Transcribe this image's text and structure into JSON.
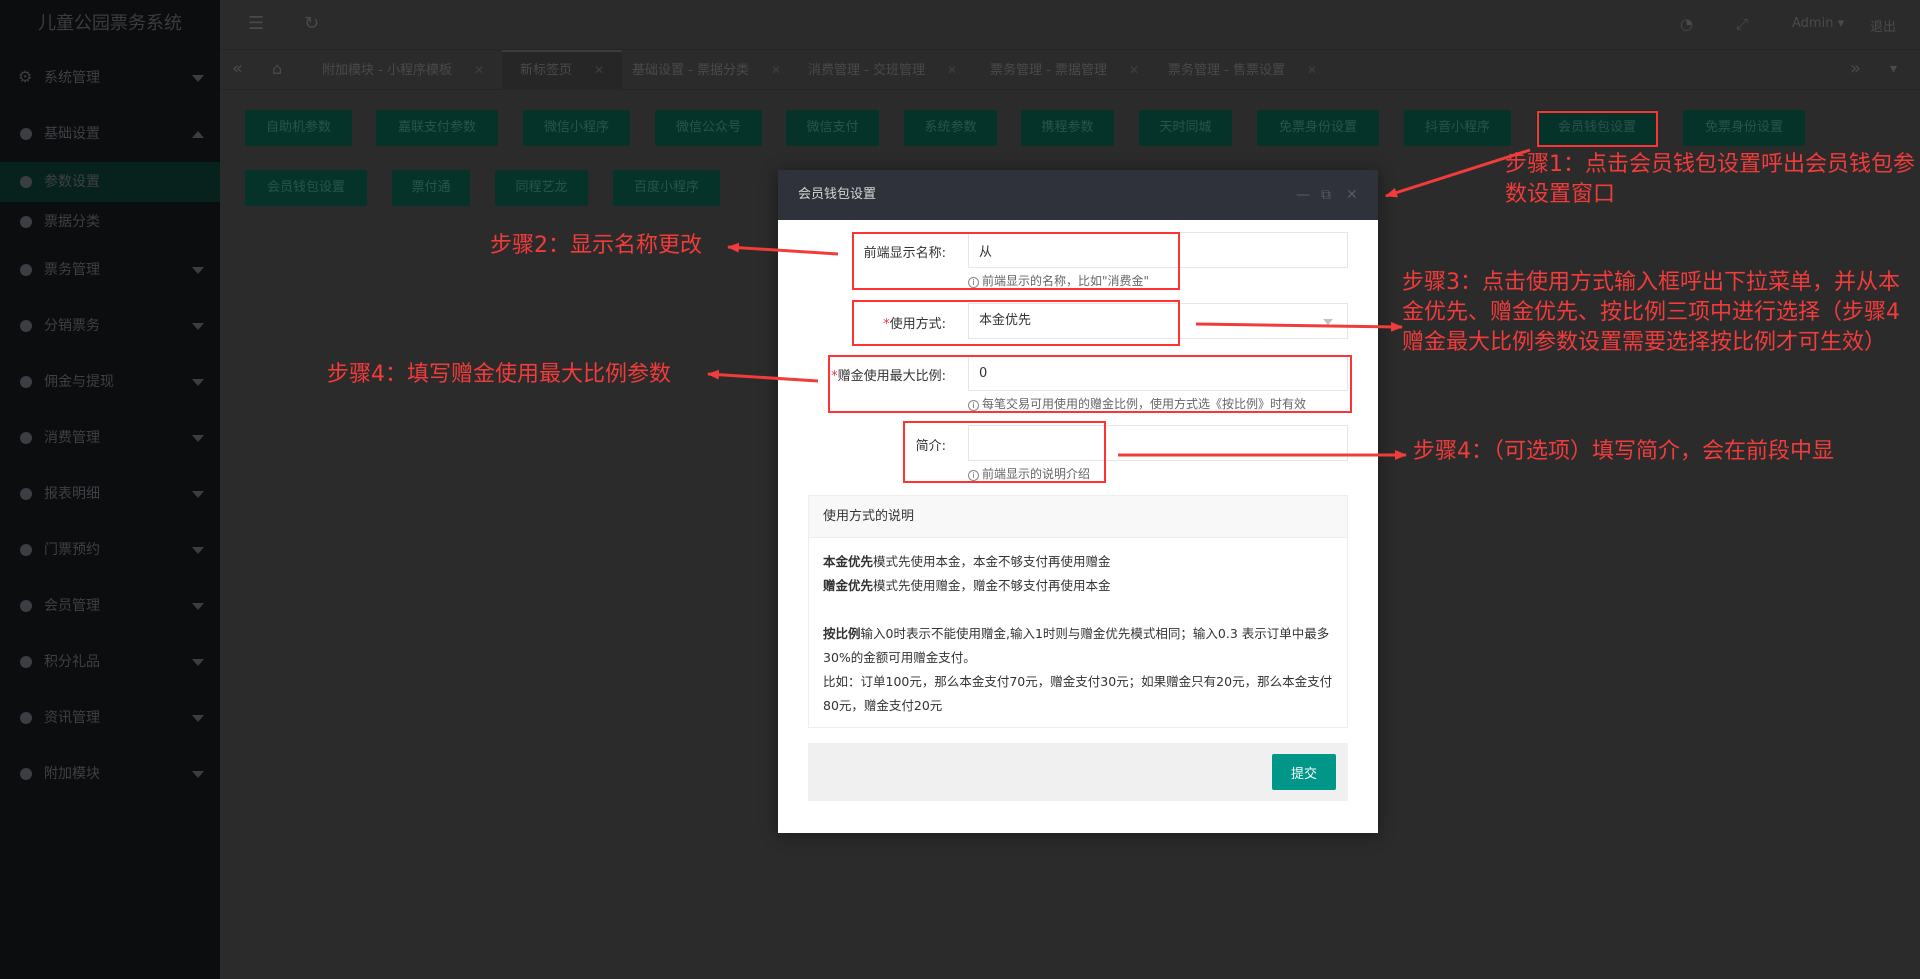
{
  "app": {
    "title": "儿童公园票务系统"
  },
  "sidebar": {
    "items": [
      {
        "label": "系统管理",
        "icon": "gear-icon"
      },
      {
        "label": "基础设置",
        "icon": "dot-icon",
        "expanded": true,
        "children": [
          {
            "label": "参数设置",
            "active": true
          },
          {
            "label": "票据分类"
          }
        ]
      },
      {
        "label": "票务管理"
      },
      {
        "label": "分销票务"
      },
      {
        "label": "佣金与提现"
      },
      {
        "label": "消费管理"
      },
      {
        "label": "报表明细"
      },
      {
        "label": "门票预约"
      },
      {
        "label": "会员管理"
      },
      {
        "label": "积分礼品"
      },
      {
        "label": "资讯管理"
      },
      {
        "label": "附加模块"
      }
    ]
  },
  "header": {
    "user": "Admin",
    "logout": "退出"
  },
  "tabs": [
    {
      "label": "附加模块 - 小程序模板"
    },
    {
      "label": "新标签页",
      "active": true
    },
    {
      "label": "基础设置 - 票据分类"
    },
    {
      "label": "消费管理 - 交班管理"
    },
    {
      "label": "票务管理 - 票据管理"
    },
    {
      "label": "票务管理 - 售票设置"
    }
  ],
  "param_buttons": {
    "row1": [
      "自助机参数",
      "嘉联支付参数",
      "微信小程序",
      "微信公众号",
      "微信支付",
      "系统参数",
      "携程参数",
      "天时同城",
      "免票身份设置",
      "抖音小程序",
      "会员钱包设置",
      "免票身份设置"
    ],
    "row2": [
      "会员钱包设置",
      "票付通",
      "同程艺龙",
      "百度小程序"
    ]
  },
  "modal": {
    "title": "会员钱包设置",
    "fields": {
      "display_name": {
        "label": "前端显示名称:",
        "value": "从",
        "hint": "前端显示的名称，比如\"消费金\""
      },
      "usage_mode": {
        "label": "使用方式:",
        "value": "本金优先"
      },
      "max_ratio": {
        "label": "赠金使用最大比例:",
        "value": "0",
        "hint": "每笔交易可用使用的赠金比例，使用方式选《按比例》时有效"
      },
      "intro": {
        "label": "简介:",
        "value": "",
        "hint": "前端显示的说明介绍"
      }
    },
    "panel": {
      "title": "使用方式的说明",
      "line1_bold": "本金优先",
      "line1_rest": "模式先使用本金，本金不够支付再使用赠金",
      "line2_bold": "赠金优先",
      "line2_rest": "模式先使用赠金，赠金不够支付再使用本金",
      "line3_bold": "按比例",
      "line3_rest": "输入0时表示不能使用赠金,输入1时则与赠金优先模式相同；输入0.3 表示订单中最多30%的金额可用赠金支付。",
      "line4": "比如：订单100元，那么本金支付70元，赠金支付30元；如果赠金只有20元，那么本金支付80元，赠金支付20元"
    },
    "submit_label": "提交"
  },
  "annotations": {
    "step1": "步骤1：点击会员钱包设置呼出会员钱包参数设置窗口",
    "step2": "步骤2：显示名称更改",
    "step3": "步骤3：点击使用方式输入框呼出下拉菜单，并从本金优先、赠金优先、按比例三项中进行选择（步骤4赠金最大比例参数设置需要选择按比例才可生效）",
    "step4a": "步骤4：填写赠金使用最大比例参数",
    "step4b": "步骤4：（可选项）填写简介，会在前段中显",
    "color": "#f23b3b"
  }
}
